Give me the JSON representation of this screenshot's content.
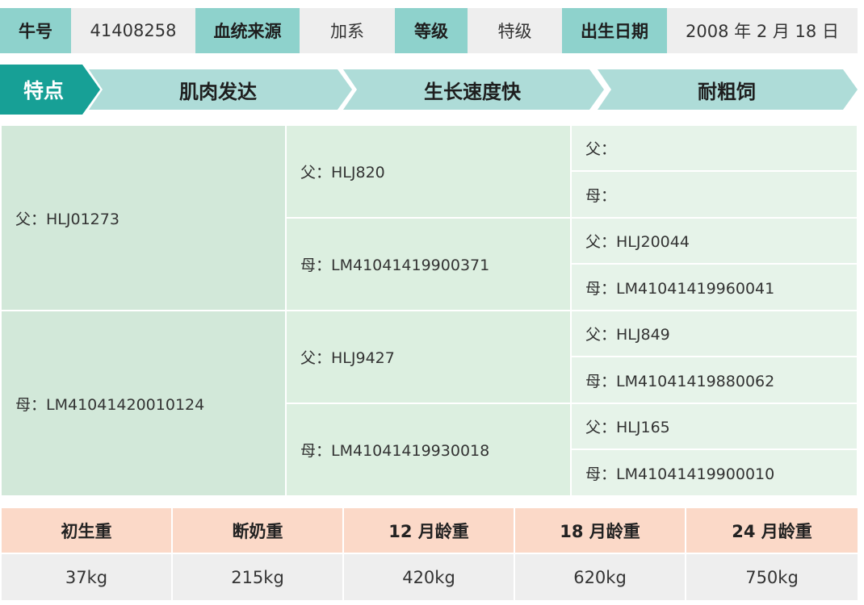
{
  "header": {
    "id_label": "牛号",
    "id_value": "41408258",
    "source_label": "血统来源",
    "source_value": "加系",
    "grade_label": "等级",
    "grade_value": "特级",
    "birth_label": "出生日期",
    "birth_value": "2008 年 2 月 18 日"
  },
  "features": {
    "label": "特点",
    "items": [
      "肌肉发达",
      "生长速度快",
      "耐粗饲"
    ]
  },
  "pedigree": {
    "sire": "父：HLJ01273",
    "dam": "母：LM41041420010124",
    "sire_sire": "父：HLJ820",
    "sire_dam": "母：LM41041419900371",
    "dam_sire": "父：HLJ9427",
    "dam_dam": "母：LM41041419930018",
    "g3": [
      "父：",
      "母：",
      "父：HLJ20044",
      "母：LM41041419960041",
      "父：HLJ849",
      "母：LM41041419880062",
      "父：HLJ165",
      "母：LM41041419900010"
    ]
  },
  "weights": {
    "headers": [
      "初生重",
      "断奶重",
      "12 月龄重",
      "18 月龄重",
      "24 月龄重"
    ],
    "values": [
      "37kg",
      "215kg",
      "420kg",
      "620kg",
      "750kg"
    ]
  },
  "colors": {
    "teal_dark": "#17a096",
    "teal_light": "#8ed2cc",
    "cell_grey": "#eeeeee",
    "pedigree_green": "#d2e8d9",
    "weight_header": "#fbd9c8"
  }
}
